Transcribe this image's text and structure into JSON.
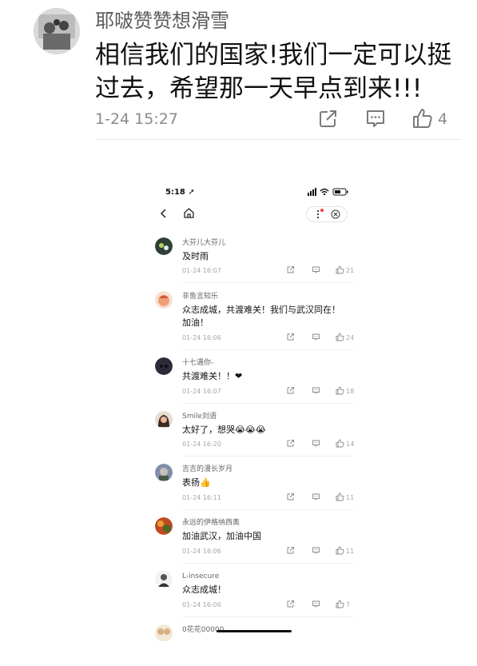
{
  "main_comment": {
    "username": "耶啵赞赞想滑雪",
    "text_lines": [
      "相信我们的国家!我们一定可以挺",
      "过去，希望那一天早点到来!!!"
    ],
    "time": "1-24 15:27",
    "like_count": "4",
    "icons": [
      "share-icon",
      "comment-icon",
      "like-icon"
    ]
  },
  "phone": {
    "status_time": "5:18",
    "comments": [
      {
        "name": "大芬儿大芬儿",
        "lines": [
          "及时雨"
        ],
        "time": "01-24 16:07",
        "likes": "21",
        "avatar_color": "#2e3f35"
      },
      {
        "name": "非鱼言知乐",
        "lines": [
          "众志成城，共渡难关！我们与武汉同在！",
          "加油！"
        ],
        "time": "01-24 16:06",
        "likes": "24",
        "avatar_color": "#f0a078"
      },
      {
        "name": "十七遇你-",
        "lines": [
          "共渡难关！！❤"
        ],
        "time": "01-24 16:07",
        "likes": "18",
        "avatar_color": "#2b2b3a"
      },
      {
        "name": "Smile刘语",
        "lines": [
          "太好了，想哭😭😭😭"
        ],
        "time": "01-24 16:20",
        "likes": "14",
        "avatar_color": "#b08a70"
      },
      {
        "name": "吉吉的漫长岁月",
        "lines": [
          "表扬👍"
        ],
        "time": "01-24 16:11",
        "likes": "11",
        "avatar_color": "#7f8fa8"
      },
      {
        "name": "永远的伊格纳西奥",
        "lines": [
          "加油武汉，加油中国"
        ],
        "time": "01-24 16:06",
        "likes": "11",
        "avatar_color": "#d06030"
      },
      {
        "name": "L-insecure",
        "lines": [
          "众志成城！"
        ],
        "time": "01-24 16:06",
        "likes": "7",
        "avatar_color": "#e8e8e8"
      },
      {
        "name": "0花花00000",
        "lines": [],
        "time": "",
        "likes": "",
        "avatar_color": "#d8b080"
      }
    ]
  }
}
